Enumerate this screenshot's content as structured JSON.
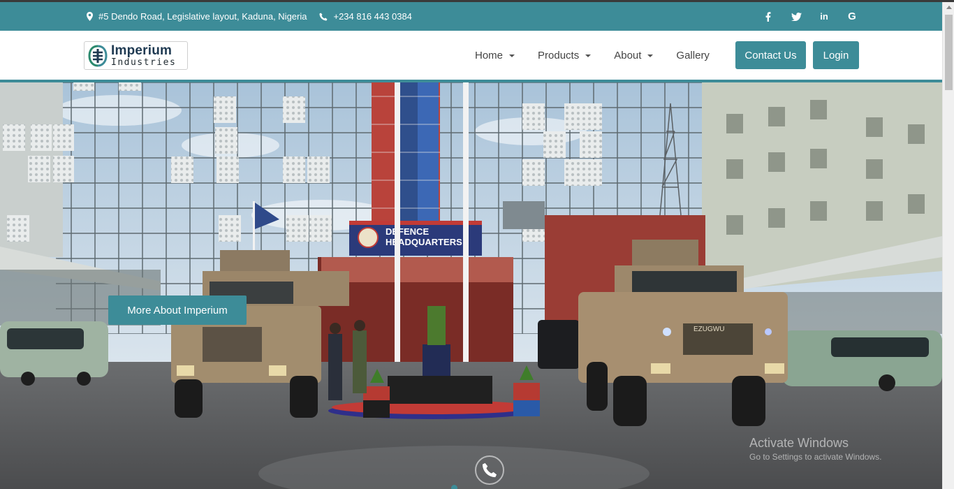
{
  "topbar": {
    "address": "#5 Dendo Road, Legislative layout, Kaduna, Nigeria",
    "phone": "+234 816 443 0384",
    "social": [
      {
        "icon": "facebook-icon",
        "glyph": "f"
      },
      {
        "icon": "twitter-icon",
        "glyph": "🐦"
      },
      {
        "icon": "linkedin-icon",
        "glyph": "in"
      },
      {
        "icon": "google-icon",
        "glyph": "G"
      }
    ]
  },
  "brand": {
    "name_line1": "Imperium",
    "name_line2": "Industries"
  },
  "nav": {
    "items": [
      {
        "label": "Home",
        "dropdown": true
      },
      {
        "label": "Products",
        "dropdown": true
      },
      {
        "label": "About",
        "dropdown": true
      },
      {
        "label": "Gallery",
        "dropdown": false
      }
    ],
    "contact_button": "Contact Us",
    "login_button": "Login"
  },
  "hero": {
    "cta_label": "More About Imperium",
    "building_sign_line1": "DEFENCE",
    "building_sign_line2": "HEADQUARTERS",
    "vehicle_plate": "EZUGWU"
  },
  "watermark": {
    "line1": "Activate Windows",
    "line2": "Go to Settings to activate Windows."
  },
  "colors": {
    "accent": "#3d8c98",
    "header_bg": "#ffffff",
    "nav_text": "#444444"
  }
}
